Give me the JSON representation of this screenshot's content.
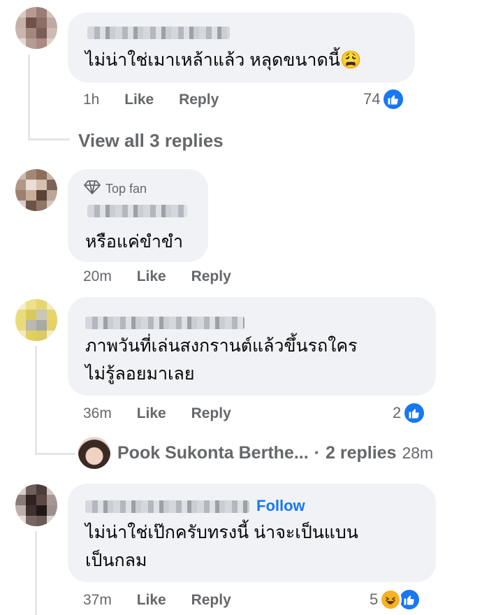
{
  "comments": [
    {
      "text_lines": [
        "ไม่น่าใช่เมาเหล้าแล้ว หลุดขนาดนี้😩"
      ],
      "time": "1h",
      "like_label": "Like",
      "reply_label": "Reply",
      "reaction_count": "74",
      "reactions": [
        "like"
      ]
    },
    {
      "badge": "Top fan",
      "text_lines": [
        "หรือแค่ขำขำ"
      ],
      "time": "20m",
      "like_label": "Like",
      "reply_label": "Reply"
    },
    {
      "text_lines": [
        "ภาพวันที่เล่นสงกรานต์แล้วขึ้นรถใคร",
        "ไม่รู้ลอยมาเลย"
      ],
      "time": "36m",
      "like_label": "Like",
      "reply_label": "Reply",
      "reaction_count": "2",
      "reactions": [
        "like"
      ]
    },
    {
      "follow_label": "Follow",
      "text_lines": [
        "ไม่น่าใช่เป๊กครับทรงนี้ น่าจะเป็นแบน",
        "เป็นกลม"
      ],
      "time": "37m",
      "like_label": "Like",
      "reply_label": "Reply",
      "reaction_count": "5",
      "reactions": [
        "haha",
        "like"
      ]
    }
  ],
  "view_replies": "View all 3 replies",
  "reply_preview": {
    "name": "Pook Sukonta Berthe...",
    "separator": "·",
    "count_text": "2 replies",
    "time": "28m"
  },
  "icons": {
    "like": "thumbs-up-icon",
    "haha": "laughing-face-icon",
    "top_fan": "diamond-icon"
  },
  "colors": {
    "bubble": "#f0f2f5",
    "meta_text": "#65676b",
    "accent": "#1877f2",
    "haha": "#f7b125"
  }
}
